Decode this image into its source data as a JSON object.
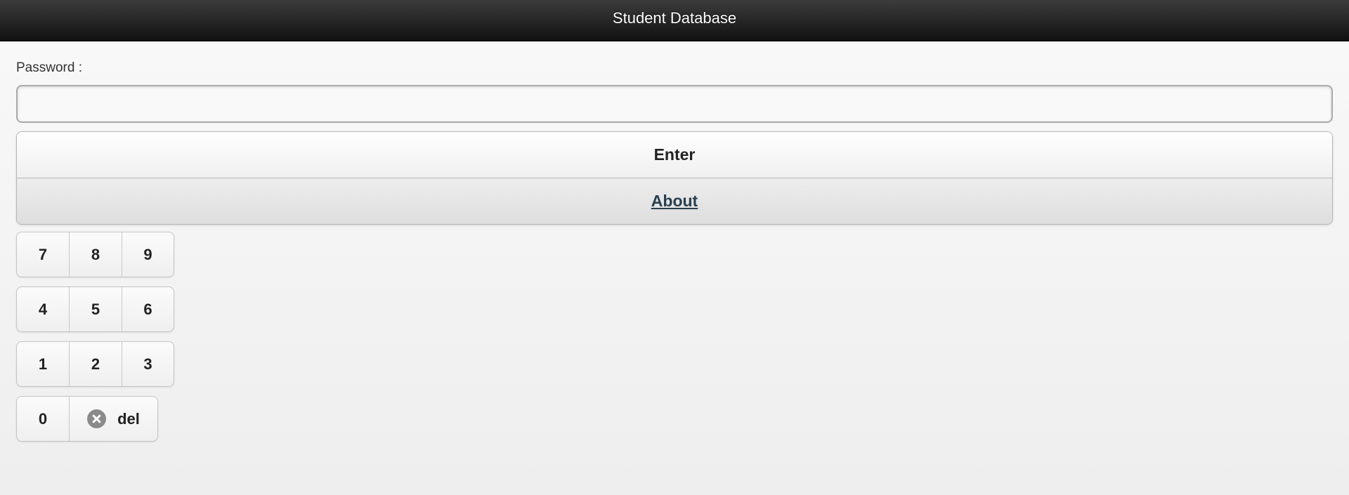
{
  "header": {
    "title": "Student Database"
  },
  "form": {
    "password_label": "Password :",
    "password_value": "",
    "password_placeholder": ""
  },
  "buttons": {
    "enter_label": "Enter",
    "about_label": "About"
  },
  "keypad": {
    "rows": [
      [
        "7",
        "8",
        "9"
      ],
      [
        "4",
        "5",
        "6"
      ],
      [
        "1",
        "2",
        "3"
      ]
    ],
    "zero_label": "0",
    "delete_label": "del",
    "delete_icon": "close-circle-icon"
  },
  "colors": {
    "header_bg": "#1a1a1a",
    "about_link": "#2a3f4f",
    "delete_icon": "#8a8a8a"
  }
}
